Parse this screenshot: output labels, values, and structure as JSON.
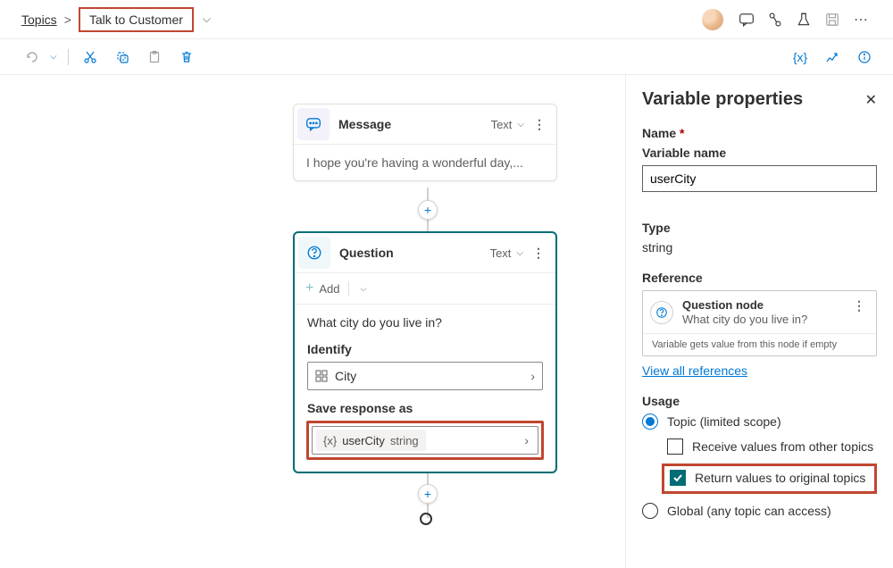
{
  "breadcrumb": {
    "root": "Topics",
    "current": "Talk to Customer"
  },
  "nodes": {
    "message": {
      "title": "Message",
      "type_label": "Text",
      "body": "I hope you're having a wonderful day,..."
    },
    "question": {
      "title": "Question",
      "type_label": "Text",
      "add_label": "Add",
      "prompt": "What city do you live in?",
      "identify_label": "Identify",
      "identify_value": "City",
      "save_label": "Save response as",
      "var_name": "userCity",
      "var_type": "string"
    }
  },
  "panel": {
    "title": "Variable properties",
    "name_label": "Name",
    "name_sublabel": "Variable name",
    "name_value": "userCity",
    "type_label": "Type",
    "type_value": "string",
    "reference_label": "Reference",
    "ref_title": "Question node",
    "ref_sub": "What city do you live in?",
    "ref_note": "Variable gets value from this node if empty",
    "view_all": "View all references",
    "usage_label": "Usage",
    "opt_topic": "Topic (limited scope)",
    "chk_receive": "Receive values from other topics",
    "chk_return": "Return values to original topics",
    "opt_global": "Global (any topic can access)"
  }
}
